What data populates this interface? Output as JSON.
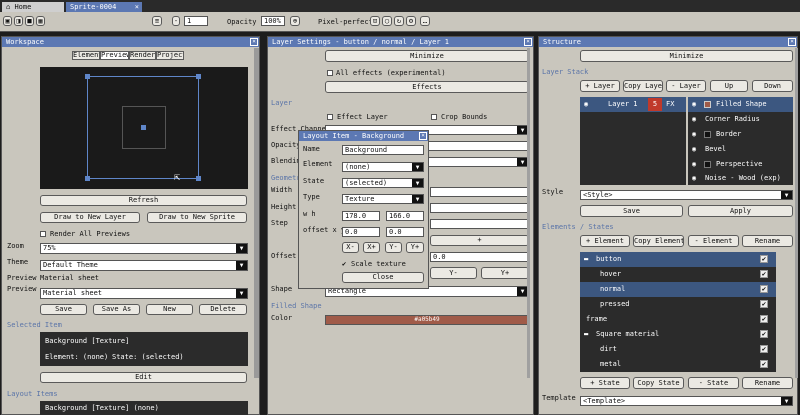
{
  "tabs": {
    "home": "Home",
    "sprite": "Sprite-0004"
  },
  "toolbar": {
    "frame": "1",
    "opacity_label": "Opacity",
    "opacity": "100%",
    "pixel_perfect": "Pixel-perfect"
  },
  "workspace": {
    "title": "Workspace",
    "tabs": [
      "Element",
      "Preview",
      "Render",
      "Project"
    ],
    "refresh": "Refresh",
    "draw_layer": "Draw to New Layer",
    "draw_sprite": "Draw to New Sprite",
    "render_all": "Render All Previews",
    "zoom_label": "Zoom",
    "zoom": "75%",
    "theme_label": "Theme",
    "theme": "Default Theme",
    "preview_label": "Preview",
    "preview_value": "Material sheet",
    "preview2_label": "Preview",
    "preview2": "Material sheet",
    "save": "Save",
    "save_as": "Save As",
    "new": "New",
    "delete": "Delete",
    "selected_section": "Selected Item",
    "sel_name": "Background  [Texture]",
    "sel_element": "Element: (none)",
    "sel_state": "State: (selected)",
    "edit": "Edit",
    "layout_section": "Layout Items",
    "layout_item": "Background [Texture] (none)"
  },
  "layer_settings": {
    "title": "Layer Settings - button / normal / Layer 1",
    "minimize": "Minimize",
    "all_effects": "All effects (experimental)",
    "effects": "Effects",
    "layer_section": "Layer",
    "effect_layer": "Effect Layer",
    "crop_bounds": "Crop Bounds",
    "effect_channel": "Effect Channel",
    "opacity": "Opacity",
    "blending": "Blending",
    "geometry_section": "Geometry",
    "width": "Width",
    "height": "Height",
    "step": "Step",
    "plus": "+",
    "offset": "Offset X",
    "offset_val": "0.0",
    "yminus": "Y-",
    "yplus": "Y+",
    "shape": "Shape",
    "shape_value": "Rectangle",
    "filled_section": "Filled Shape",
    "color_label": "Color",
    "color_hex": "#a05b49",
    "color": "#a05b49"
  },
  "layout_item": {
    "title": "Layout Item - Background",
    "name_label": "Name",
    "name": "Background",
    "element_label": "Element",
    "element": "(none)",
    "state_label": "State",
    "state": "(selected)",
    "type_label": "Type",
    "type": "Texture",
    "wh_label": "w h",
    "w": "178.0",
    "h": "166.0",
    "offset_label": "offset x y",
    "ox": "0.0",
    "oy": "0.0",
    "xm": "X-",
    "xp": "X+",
    "ym": "Y-",
    "yp": "Y+",
    "scale_texture": "Scale texture",
    "close": "Close"
  },
  "structure": {
    "title": "Structure",
    "minimize": "Minimize",
    "layer_stack_section": "Layer Stack",
    "add_layer": "+ Layer",
    "copy_layer": "Copy Layer",
    "remove_layer": "- Layer",
    "up": "Up",
    "down": "Down",
    "layer_name": "Layer 1",
    "layer_num": "5",
    "layer_fx": "FX",
    "effects": [
      {
        "name": "Filled Shape",
        "color": "#a05b49"
      },
      {
        "name": "Corner Radius",
        "color": ""
      },
      {
        "name": "Border",
        "color": "#111111"
      },
      {
        "name": "Bevel",
        "color": ""
      },
      {
        "name": "Perspective",
        "color": "#111111"
      },
      {
        "name": "Noise - Wood (exp)",
        "color": ""
      }
    ],
    "style_label": "Style",
    "style": "<Style>",
    "save": "Save",
    "apply": "Apply",
    "elements_section": "Elements / States",
    "add_element": "+ Element",
    "copy_element": "Copy Element",
    "remove_element": "- Element",
    "rename": "Rename",
    "tree": [
      {
        "name": "button",
        "indent": 0,
        "group": true
      },
      {
        "name": "hover",
        "indent": 1,
        "group": false
      },
      {
        "name": "normal",
        "indent": 1,
        "group": false
      },
      {
        "name": "pressed",
        "indent": 1,
        "group": false
      },
      {
        "name": "frame",
        "indent": 0,
        "group": false
      },
      {
        "name": "Square material",
        "indent": 0,
        "group": true
      },
      {
        "name": "dirt",
        "indent": 1,
        "group": false
      },
      {
        "name": "metal",
        "indent": 1,
        "group": false
      }
    ],
    "add_state": "+ State",
    "copy_state": "Copy State",
    "remove_state": "- State",
    "rename2": "Rename",
    "template_label": "Template",
    "template": "<Template>"
  }
}
